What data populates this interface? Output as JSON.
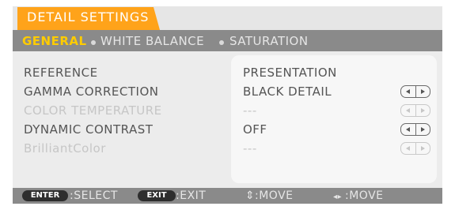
{
  "window": {
    "title": "DETAIL SETTINGS"
  },
  "tabs": [
    {
      "label": "GENERAL",
      "active": true
    },
    {
      "label": "WHITE BALANCE",
      "active": false
    },
    {
      "label": "SATURATION",
      "active": false
    }
  ],
  "rows": [
    {
      "label": "REFERENCE",
      "value": "PRESENTATION",
      "enabled": true,
      "has_arrows": false
    },
    {
      "label": "GAMMA CORRECTION",
      "value": "BLACK DETAIL",
      "enabled": true,
      "has_arrows": true
    },
    {
      "label": "COLOR TEMPERATURE",
      "value": "---",
      "enabled": false,
      "has_arrows": true
    },
    {
      "label": "DYNAMIC CONTRAST",
      "value": "OFF",
      "enabled": true,
      "has_arrows": true
    },
    {
      "label": "BrilliantColor",
      "value": "---",
      "enabled": false,
      "has_arrows": true
    }
  ],
  "footer": {
    "enter_key": "ENTER",
    "enter_action": ":SELECT",
    "exit_key": "EXIT",
    "exit_action": ":EXIT",
    "updown_glyph": "⇕",
    "updown_action": ":MOVE",
    "leftright_glyph": "◂▸",
    "leftright_action": ":MOVE"
  },
  "colors": {
    "title_tab": "#ffa31a",
    "active_tab": "#ffcc00",
    "bar": "#8a8a8a",
    "menu_bg": "#ececec",
    "panel_bg": "#f7f7f7",
    "text": "#555555",
    "disabled_text": "#c6c6c6"
  }
}
